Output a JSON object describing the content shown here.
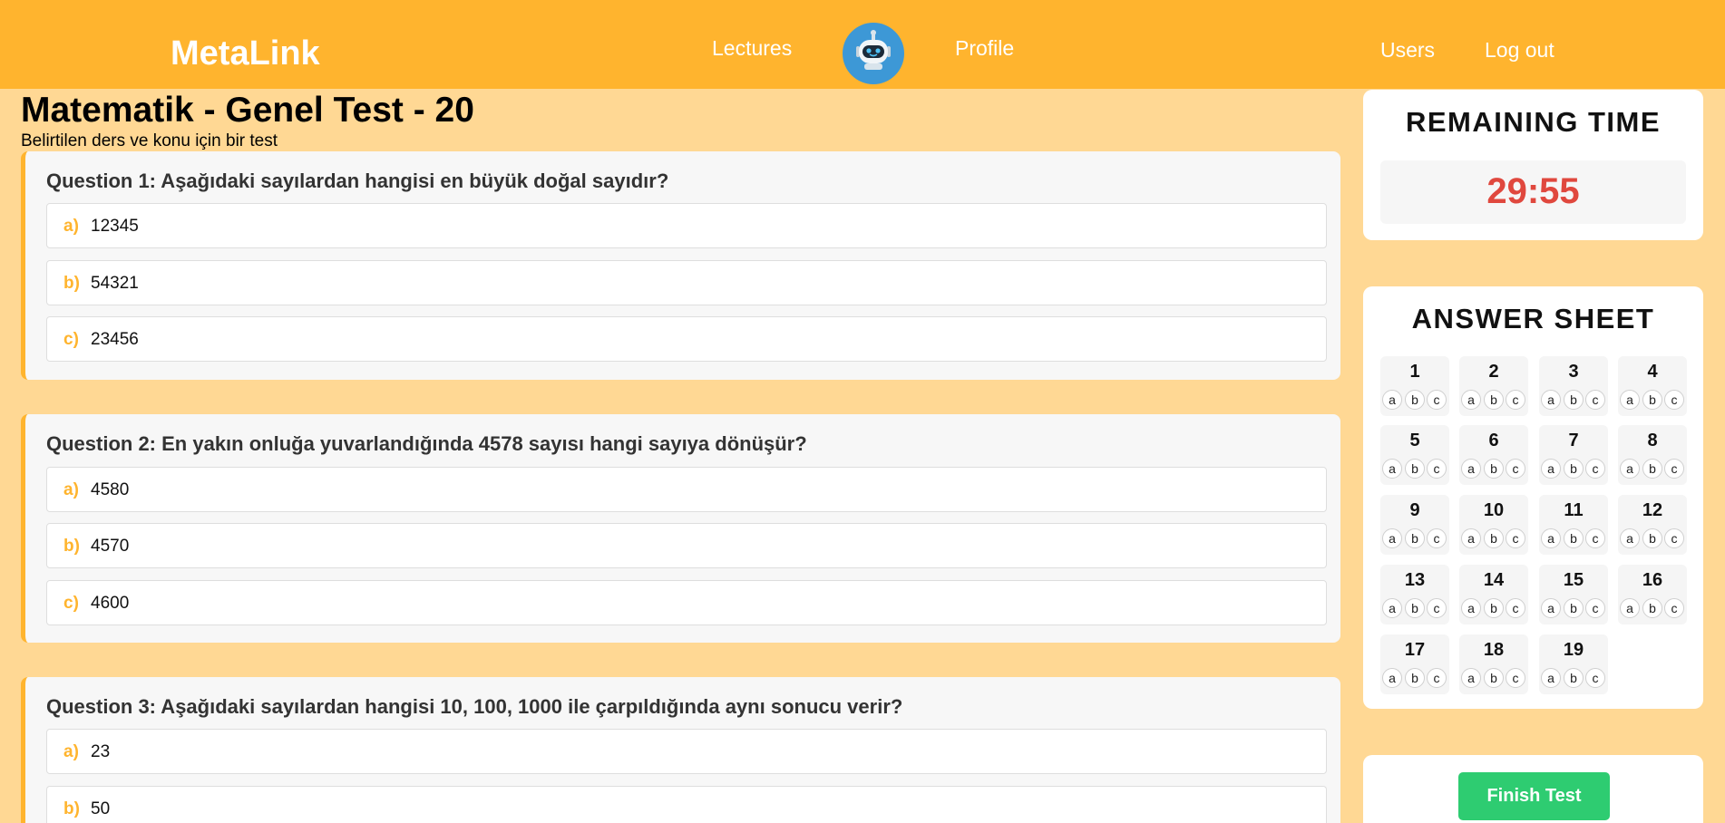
{
  "nav": {
    "brand": "MetaLink",
    "lectures": "Lectures",
    "profile": "Profile",
    "users": "Users",
    "logout": "Log out",
    "accent_color": "#ffb42e"
  },
  "page": {
    "title": "Matematik - Genel Test - 20",
    "subtitle": "Belirtilen ders ve konu için bir test"
  },
  "questions": [
    {
      "title": "Question 1: Aşağıdaki sayılardan hangisi en büyük doğal sayıdır?",
      "options": [
        {
          "letter": "a)",
          "text": "12345"
        },
        {
          "letter": "b)",
          "text": "54321"
        },
        {
          "letter": "c)",
          "text": "23456"
        }
      ]
    },
    {
      "title": "Question 2: En yakın onluğa yuvarlandığında 4578 sayısı hangi sayıya dönüşür?",
      "options": [
        {
          "letter": "a)",
          "text": "4580"
        },
        {
          "letter": "b)",
          "text": "4570"
        },
        {
          "letter": "c)",
          "text": "4600"
        }
      ]
    },
    {
      "title": "Question 3: Aşağıdaki sayılardan hangisi 10, 100, 1000 ile çarpıldığında aynı sonucu verir?",
      "options": [
        {
          "letter": "a)",
          "text": "23"
        },
        {
          "letter": "b)",
          "text": "50"
        }
      ]
    }
  ],
  "timer": {
    "title": "REMAINING TIME",
    "value": "29:55",
    "color": "#e0483e"
  },
  "answer_sheet": {
    "title": "ANSWER SHEET",
    "choice_labels": [
      "a",
      "b",
      "c"
    ],
    "numbers": [
      "1",
      "2",
      "3",
      "4",
      "5",
      "6",
      "7",
      "8",
      "9",
      "10",
      "11",
      "12",
      "13",
      "14",
      "15",
      "16",
      "17",
      "18",
      "19"
    ]
  },
  "finish": {
    "label": "Finish Test",
    "color": "#2ecc71"
  }
}
